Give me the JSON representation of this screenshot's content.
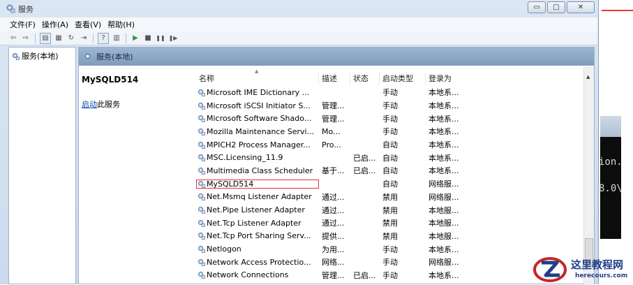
{
  "window": {
    "title": "服务",
    "btn_minimize": "▭",
    "btn_maximize": "□",
    "btn_close": "✕"
  },
  "menu": [
    "文件(F)",
    "操作(A)",
    "查看(V)",
    "帮助(H)"
  ],
  "toolbar": {
    "icons": [
      "back-arrow-icon",
      "forward-arrow-icon",
      "console-tree-icon",
      "properties-icon",
      "refresh-icon",
      "export-icon",
      "help-icon",
      "view-icon",
      "play-icon",
      "stop-icon",
      "pause-icon",
      "restart-icon"
    ],
    "glyphs": [
      "⇦",
      "⇨",
      "▤",
      "▦",
      "↻",
      "⇥",
      "?",
      "▥",
      "▶",
      "■",
      "❚❚",
      "❚▶"
    ]
  },
  "tree": {
    "root": "服务(本地)"
  },
  "panel": {
    "header": "服务(本地)",
    "selected_name": "MySQLD514",
    "action_link": "启动",
    "action_text": "此服务"
  },
  "list": {
    "columns": [
      "名称",
      "描述",
      "状态",
      "启动类型",
      "登录为"
    ],
    "selected_index": 7,
    "rows": [
      {
        "name": "Microsoft IME Dictionary ...",
        "desc": "",
        "status": "",
        "startup": "手动",
        "logon": "本地系..."
      },
      {
        "name": "Microsoft iSCSI Initiator S...",
        "desc": "管理...",
        "status": "",
        "startup": "手动",
        "logon": "本地系..."
      },
      {
        "name": "Microsoft Software Shado...",
        "desc": "管理...",
        "status": "",
        "startup": "手动",
        "logon": "本地系..."
      },
      {
        "name": "Mozilla Maintenance Servi...",
        "desc": "Mo...",
        "status": "",
        "startup": "手动",
        "logon": "本地系..."
      },
      {
        "name": "MPICH2 Process Manager...",
        "desc": "Pro...",
        "status": "",
        "startup": "自动",
        "logon": "本地系..."
      },
      {
        "name": "MSC.Licensing_11.9",
        "desc": "",
        "status": "已启...",
        "startup": "自动",
        "logon": "本地系..."
      },
      {
        "name": "Multimedia Class Scheduler",
        "desc": "基于...",
        "status": "已启...",
        "startup": "自动",
        "logon": "本地系..."
      },
      {
        "name": "MySQLD514",
        "desc": "",
        "status": "",
        "startup": "自动",
        "logon": "网络服..."
      },
      {
        "name": "Net.Msmq Listener Adapter",
        "desc": "通过...",
        "status": "",
        "startup": "禁用",
        "logon": "网络服..."
      },
      {
        "name": "Net.Pipe Listener Adapter",
        "desc": "通过...",
        "status": "",
        "startup": "禁用",
        "logon": "本地服..."
      },
      {
        "name": "Net.Tcp Listener Adapter",
        "desc": "通过...",
        "status": "",
        "startup": "禁用",
        "logon": "本地服..."
      },
      {
        "name": "Net.Tcp Port Sharing Serv...",
        "desc": "提供...",
        "status": "",
        "startup": "禁用",
        "logon": "本地服..."
      },
      {
        "name": "Netlogon",
        "desc": "为用...",
        "status": "",
        "startup": "手动",
        "logon": "本地系..."
      },
      {
        "name": "Network Access Protectio...",
        "desc": "网络...",
        "status": "",
        "startup": "手动",
        "logon": "网络服..."
      },
      {
        "name": "Network Connections",
        "desc": "管理...",
        "status": "已启...",
        "startup": "手动",
        "logon": "本地系..."
      }
    ]
  },
  "console": {
    "line1": "ion.",
    "line2": "8.0\\"
  },
  "watermark": {
    "cn": "这里教程网",
    "url": "herecours.com"
  },
  "colors": {
    "accent_header": "#8aa6c8",
    "selection_outline": "#e0353a",
    "link": "#0645ad"
  }
}
